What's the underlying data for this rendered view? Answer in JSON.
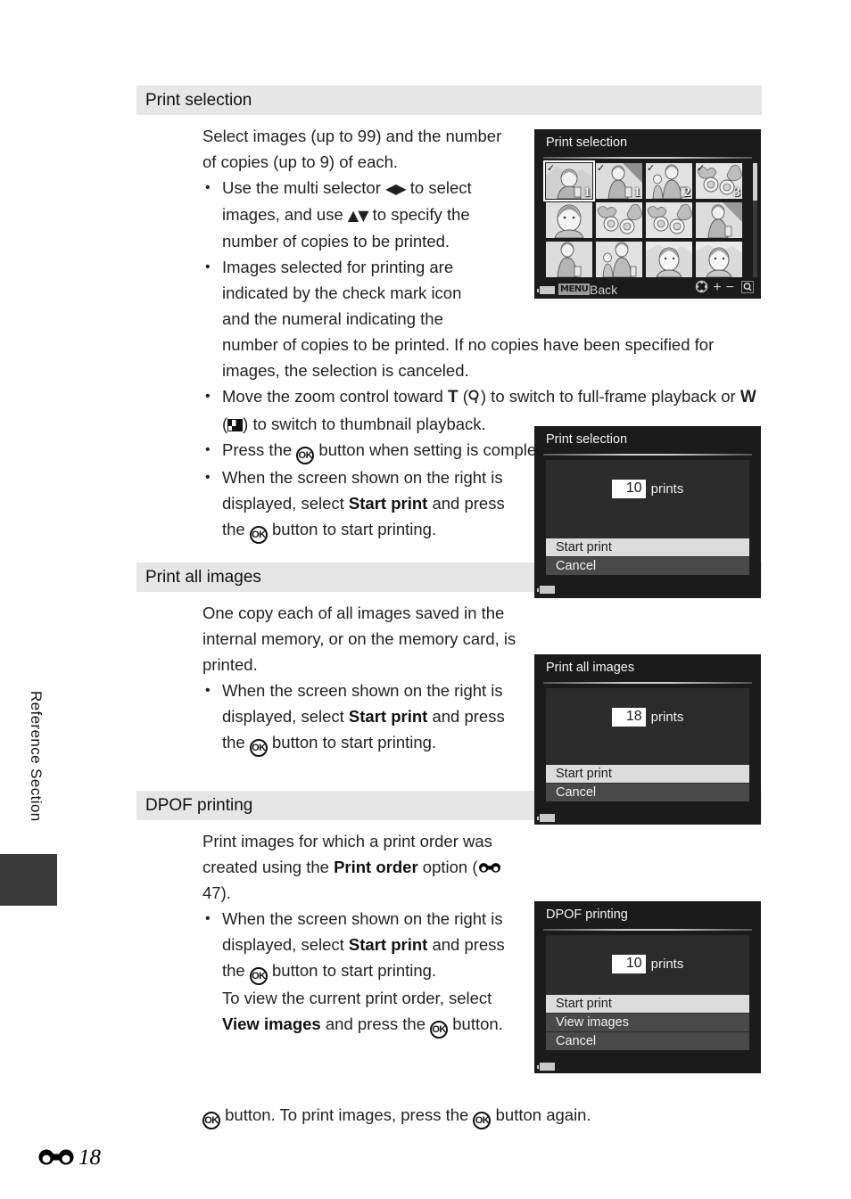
{
  "page": {
    "side_tab_label": "Reference Section",
    "footer_page": "18",
    "footer_symbol": "reference-section-symbol"
  },
  "sections": [
    {
      "id": "print-selection",
      "heading": "Print selection",
      "intro": "Select images (up to 99) and the number of copies (up to 9) of each.",
      "bullets": [
        "Use the multi selector ◀▶ to select images, and use ▲▼ to specify the number of copies to be printed.",
        "Images selected for printing are indicated by the check mark icon and the numeral indicating the number of copies to be printed. If no copies have been specified for images, the selection is canceled.",
        "Move the zoom control toward T (⌕) to switch to full-frame playback or W (▦) to switch to thumbnail playback.",
        "Press the OK button when setting is complete.",
        "When the screen shown on the right is displayed, select Start print and press the OK button to start printing."
      ]
    },
    {
      "id": "print-all-images",
      "heading": "Print all images",
      "intro": "One copy each of all images saved in the internal memory, or on the memory card, is printed.",
      "bullets": [
        "When the screen shown on the right is displayed, select Start print and press the OK button to start printing."
      ]
    },
    {
      "id": "dpof-printing",
      "heading": "DPOF printing",
      "intro_prefix": "Print images for which a print order was created using the ",
      "intro_bold": "Print order",
      "intro_suffix": " option (",
      "intro_ref": "47",
      "intro_end": ").",
      "bullets": [
        "When the screen shown on the right is displayed, select Start print and press the OK button to start printing. To view the current print order, select View images and press the OK button. To print images, press the OK button again."
      ]
    }
  ],
  "screens": {
    "print_selection_grid": {
      "title": "Print selection",
      "status_menu_chip": "MENU",
      "status_back_label": "Back",
      "thumbnails": [
        {
          "checked": true,
          "copies": "1",
          "selected": false,
          "art": "woman-child"
        },
        {
          "checked": true,
          "copies": "1",
          "selected": false,
          "art": "woman-bag"
        },
        {
          "checked": true,
          "copies": "2",
          "selected": true,
          "art": "child-woman"
        },
        {
          "checked": true,
          "copies": "3",
          "selected": false,
          "art": "flowers"
        },
        {
          "checked": false,
          "copies": "",
          "selected": false,
          "art": "portrait"
        },
        {
          "checked": false,
          "copies": "",
          "selected": false,
          "art": "flowers"
        },
        {
          "checked": false,
          "copies": "",
          "selected": false,
          "art": "flowers"
        },
        {
          "checked": false,
          "copies": "",
          "selected": false,
          "art": "woman-bag"
        },
        {
          "checked": false,
          "copies": "",
          "selected": false,
          "art": "woman-bag"
        },
        {
          "checked": false,
          "copies": "",
          "selected": false,
          "art": "child-woman"
        },
        {
          "checked": false,
          "copies": "",
          "selected": false,
          "art": "portrait-landscape"
        },
        {
          "checked": false,
          "copies": "",
          "selected": false,
          "art": "portrait-landscape"
        }
      ]
    },
    "print_selection_confirm": {
      "title": "Print selection",
      "prints_value": "10",
      "prints_label": "prints",
      "menu": [
        {
          "label": "Start print",
          "highlighted": true
        },
        {
          "label": "Cancel",
          "highlighted": false
        }
      ]
    },
    "print_all_confirm": {
      "title": "Print all images",
      "prints_value": "18",
      "prints_label": "prints",
      "menu": [
        {
          "label": "Start print",
          "highlighted": true
        },
        {
          "label": "Cancel",
          "highlighted": false
        }
      ]
    },
    "dpof_confirm": {
      "title": "DPOF printing",
      "prints_value": "10",
      "prints_label": "prints",
      "menu": [
        {
          "label": "Start print",
          "highlighted": true
        },
        {
          "label": "View images",
          "highlighted": false
        },
        {
          "label": "Cancel",
          "highlighted": false
        }
      ]
    }
  },
  "colors": {
    "section_head_bg": "#e6e6e6",
    "screen_bg": "#1b1b1b",
    "panel_bg": "#2c2c2c",
    "menu_bg": "#4a4a4a",
    "menu_highlight_bg": "#dcdcdc",
    "text": "#231f20"
  }
}
